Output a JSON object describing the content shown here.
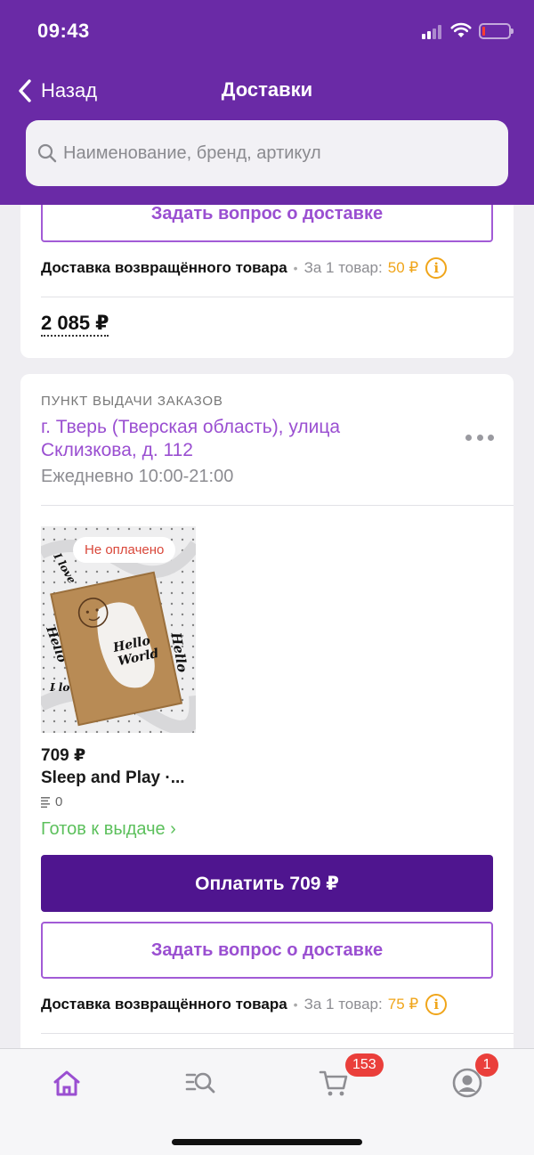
{
  "status_bar": {
    "time": "09:43"
  },
  "header": {
    "back_label": "Назад",
    "title": "Доставки"
  },
  "search": {
    "placeholder": "Наименование, бренд, артикул"
  },
  "delivery_1": {
    "ask_button": "Задать вопрос о доставке",
    "return_label": "Доставка возвращённого товара",
    "per_item_label": "За 1 товар:",
    "return_price": "50 ₽",
    "total": "2 085 ₽"
  },
  "delivery_2": {
    "section_label": "ПУНКТ ВЫДАЧИ ЗАКАЗОВ",
    "address": "г. Тверь (Тверская область), улица Склизкова, д. 112",
    "hours": "Ежедневно 10:00-21:00",
    "product": {
      "badge": "Не оплачено",
      "price": "709 ₽",
      "name": "Sleep and Play ·...",
      "qty": "0",
      "status": "Готов к выдаче ›"
    },
    "pay_button": "Оплатить 709 ₽",
    "ask_button": "Задать вопрос о доставке",
    "return_label": "Доставка возвращённого товара",
    "per_item_label": "За 1 товар:",
    "return_price": "75 ₽"
  },
  "tabbar": {
    "items": [
      {
        "name": "home",
        "icon": "home-icon",
        "active": true
      },
      {
        "name": "catalog",
        "icon": "catalog-search-icon"
      },
      {
        "name": "cart",
        "icon": "cart-icon",
        "badge": "153"
      },
      {
        "name": "profile",
        "icon": "profile-icon",
        "badge": "1"
      }
    ]
  },
  "colors": {
    "brand": "#6a2aa6",
    "pay_button": "#4f158f",
    "accent_text": "#9a4fd1",
    "ready": "#5cc05c",
    "price_orange": "#f0a51a",
    "badge_red": "#ea3f3b"
  }
}
